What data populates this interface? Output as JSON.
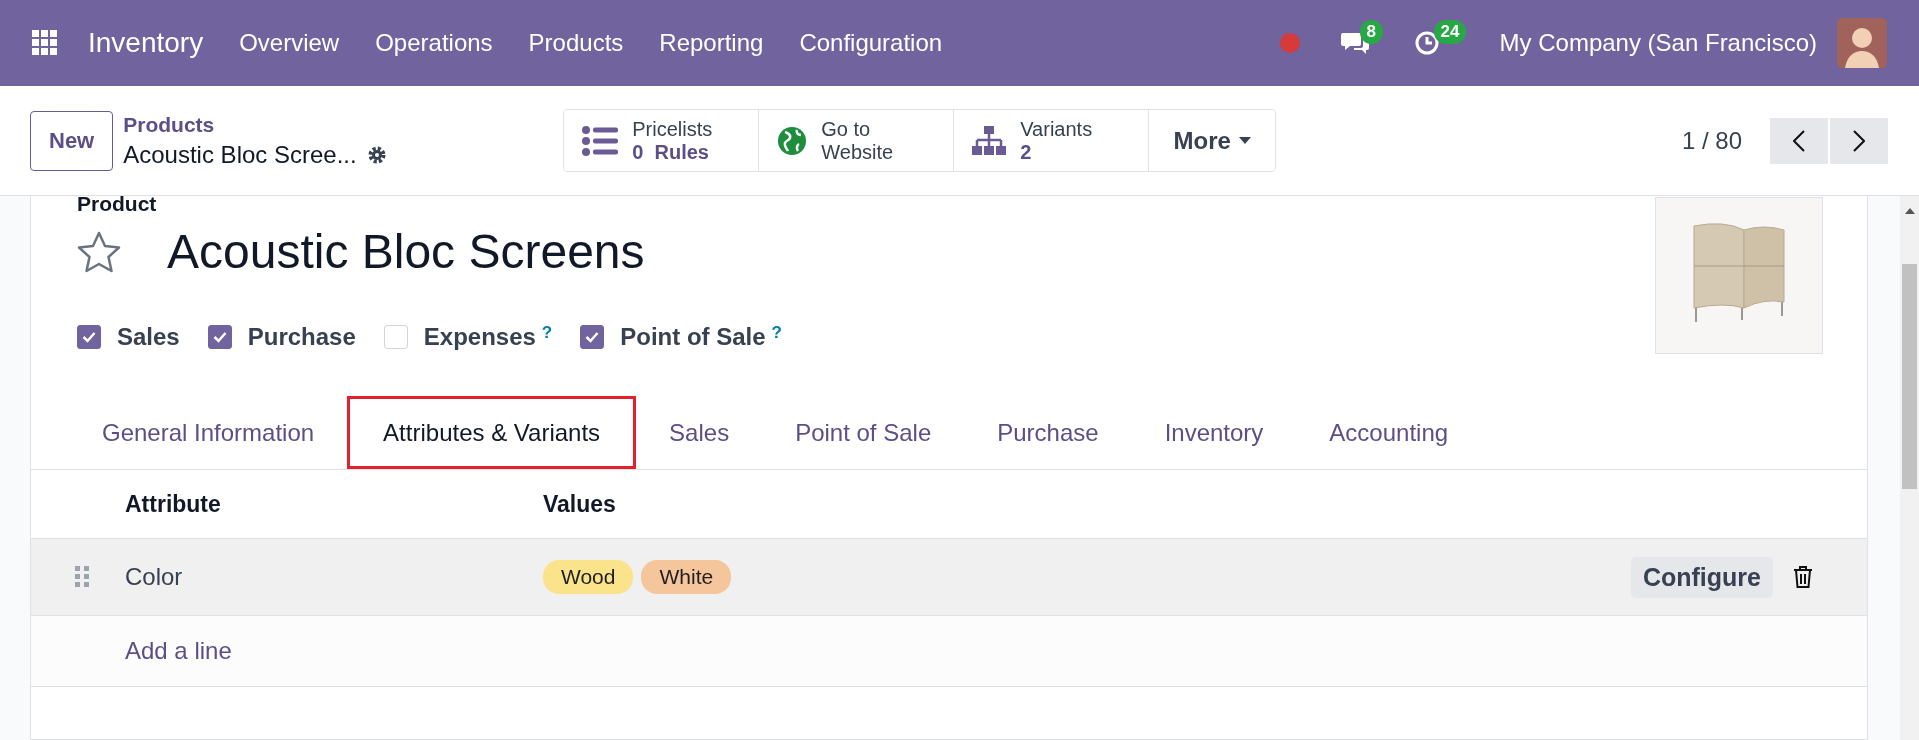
{
  "navbar": {
    "app_name": "Inventory",
    "menu": [
      "Overview",
      "Operations",
      "Products",
      "Reporting",
      "Configuration"
    ],
    "messages_count": "8",
    "activities_count": "24",
    "company": "My Company (San Francisco)"
  },
  "control_panel": {
    "new_button": "New",
    "breadcrumb": "Products",
    "record_name": "Acoustic Bloc Scree...",
    "stat_buttons": [
      {
        "kind": "list",
        "label": "Pricelists",
        "value": "0  Rules"
      },
      {
        "kind": "globe",
        "label": "Go to",
        "value": "Website"
      },
      {
        "kind": "hierarchy",
        "label": "Variants",
        "value": "2"
      }
    ],
    "more_button": "More",
    "pager": "1 / 80"
  },
  "form": {
    "field_label": "Product",
    "favorite": false,
    "title": "Acoustic Bloc Screens",
    "options": [
      {
        "label": "Sales",
        "checked": true,
        "help": false
      },
      {
        "label": "Purchase",
        "checked": true,
        "help": false
      },
      {
        "label": "Expenses",
        "checked": false,
        "help": true
      },
      {
        "label": "Point of Sale",
        "checked": true,
        "help": true
      }
    ],
    "help_mark": "?",
    "tabs": [
      {
        "label": "General Information",
        "selected": false
      },
      {
        "label": "Attributes & Variants",
        "selected": true
      },
      {
        "label": "Sales",
        "selected": false
      },
      {
        "label": "Point of Sale",
        "selected": false
      },
      {
        "label": "Purchase",
        "selected": false
      },
      {
        "label": "Inventory",
        "selected": false
      },
      {
        "label": "Accounting",
        "selected": false
      }
    ],
    "table": {
      "columns": [
        "Attribute",
        "Values"
      ],
      "rows": [
        {
          "attribute": "Color",
          "values": [
            {
              "label": "Wood",
              "color": "#fbe38b"
            },
            {
              "label": "White",
              "color": "#f5c69b"
            }
          ],
          "action": "Configure"
        }
      ],
      "add_line": "Add a line"
    }
  }
}
